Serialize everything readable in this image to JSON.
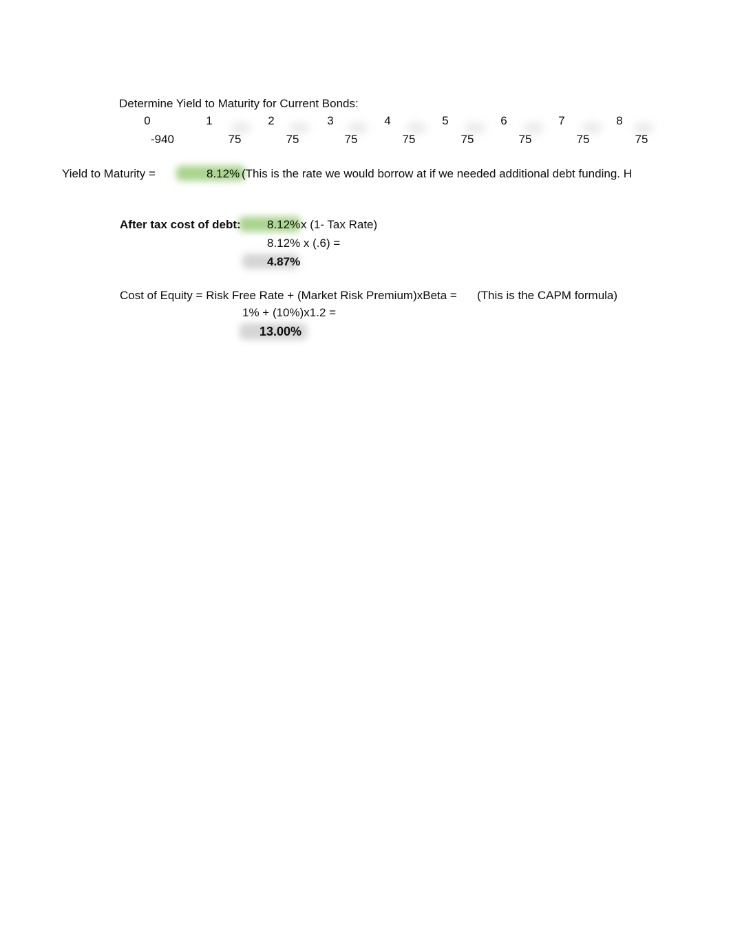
{
  "document": {
    "title_line": "Determine Yield to Maturity for Current Bonds:"
  },
  "timeline": {
    "periods": [
      "0",
      "1",
      "2",
      "3",
      "4",
      "5",
      "6",
      "7",
      "8"
    ],
    "cash_flows": [
      "-940",
      "75",
      "75",
      "75",
      "75",
      "75",
      "75",
      "75",
      "75"
    ]
  },
  "ytm": {
    "label": "Yield to Maturity =",
    "value": "8.12%",
    "note": "(This is the rate we would borrow at if we needed additional debt funding. H"
  },
  "after_tax_cost_of_debt": {
    "label": "After tax cost of debt:",
    "rate": "8.12%",
    "formula_suffix": "x (1- Tax Rate)",
    "line2": "8.12% x (.6) =",
    "result": "4.87%"
  },
  "cost_of_equity": {
    "formula": "Cost of Equity = Risk Free Rate + (Market Risk Premium)xBeta =",
    "note": "(This is the CAPM formula)",
    "line2": "1% + (10%)x1.2 =",
    "result": "13.00%"
  },
  "colors": {
    "highlight_green": "#a9d48e",
    "highlight_gray": "#d5d5d5",
    "text": "#0d0d0d"
  }
}
